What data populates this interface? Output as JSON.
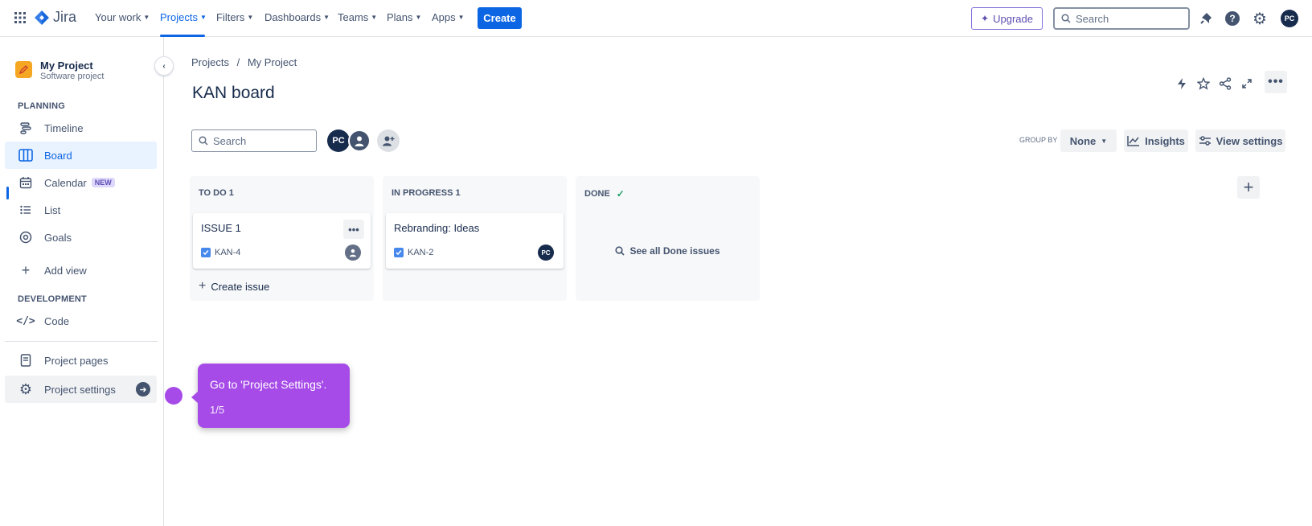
{
  "app": {
    "logo_text": "Jira"
  },
  "topnav": {
    "items": [
      "Your work",
      "Projects",
      "Filters",
      "Dashboards",
      "Teams",
      "Plans",
      "Apps"
    ],
    "create_label": "Create",
    "upgrade_label": "Upgrade",
    "search_placeholder": "Search",
    "avatar_initials": "PC"
  },
  "sidebar": {
    "project_name": "My Project",
    "project_type": "Software project",
    "planning_heading": "PLANNING",
    "planning_items": [
      {
        "label": "Timeline",
        "icon": "timeline-icon"
      },
      {
        "label": "Board",
        "icon": "board-icon",
        "selected": true
      },
      {
        "label": "Calendar",
        "icon": "calendar-icon",
        "badge": "NEW"
      },
      {
        "label": "List",
        "icon": "list-icon"
      },
      {
        "label": "Goals",
        "icon": "goals-icon"
      }
    ],
    "add_view_label": "Add view",
    "development_heading": "DEVELOPMENT",
    "code_label": "Code",
    "project_pages_label": "Project pages",
    "project_settings_label": "Project settings"
  },
  "main": {
    "breadcrumb": [
      "Projects",
      "My Project"
    ],
    "breadcrumb_sep": "/",
    "title": "KAN board",
    "search_placeholder": "Search",
    "avatar_initials": "PC",
    "group_by_label": "GROUP BY",
    "group_by_value": "None",
    "insights_label": "Insights",
    "view_settings_label": "View settings"
  },
  "board": {
    "columns": [
      {
        "title": "TO DO 1",
        "card": {
          "title": "ISSUE 1",
          "key": "KAN-4"
        },
        "create_label": "Create issue"
      },
      {
        "title": "IN PROGRESS 1",
        "card": {
          "title": "Rebranding: Ideas",
          "key": "KAN-2",
          "assignee": "PC"
        }
      },
      {
        "title": "DONE",
        "see_all_label": "See all Done issues"
      }
    ]
  },
  "tooltip": {
    "text": "Go to 'Project Settings'.",
    "step": "1/5"
  },
  "colors": {
    "accent": "#0c66e4",
    "tooltip": "#a64be8",
    "text": "#172b4d"
  }
}
